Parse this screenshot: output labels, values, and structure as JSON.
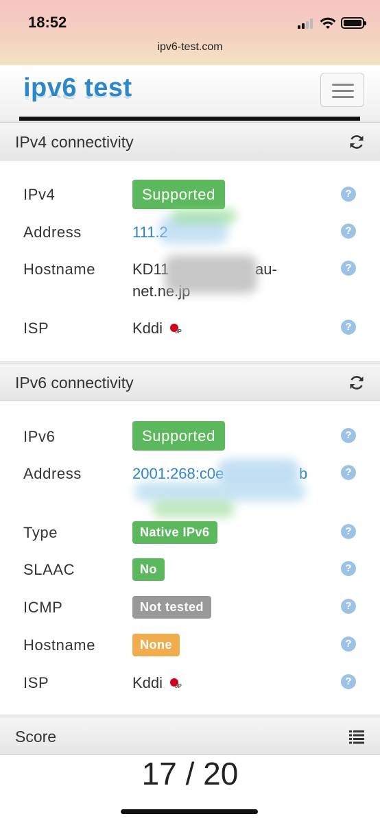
{
  "status_bar": {
    "time": "18:52"
  },
  "browser": {
    "url": "ipv6-test.com"
  },
  "navbar": {
    "logo_part1": "ipv6",
    "logo_part2": "test"
  },
  "ipv4": {
    "title": "IPv4 connectivity",
    "rows": {
      "status": {
        "label": "IPv4",
        "value": "Supported"
      },
      "address": {
        "label": "Address",
        "value": "111.2"
      },
      "hostname": {
        "label": "Hostname",
        "value_line1": "KD11",
        "value_line1_end": "au-",
        "value_line2": "net.ne.jp"
      },
      "isp": {
        "label": "ISP",
        "value": "Kddi",
        "flag_text": "JP"
      }
    }
  },
  "ipv6": {
    "title": "IPv6 connectivity",
    "rows": {
      "status": {
        "label": "IPv6",
        "value": "Supported"
      },
      "address": {
        "label": "Address",
        "value": "2001:268:c0e",
        "value_tail": "b"
      },
      "type": {
        "label": "Type",
        "value": "Native IPv6"
      },
      "slaac": {
        "label": "SLAAC",
        "value": "No"
      },
      "icmp": {
        "label": "ICMP",
        "value": "Not tested"
      },
      "hostname": {
        "label": "Hostname",
        "value": "None"
      },
      "isp": {
        "label": "ISP",
        "value": "Kddi",
        "flag_text": "JP"
      }
    }
  },
  "score": {
    "title": "Score",
    "value": "17 / 20"
  },
  "help_glyph": "?",
  "colors": {
    "success": "#5cb85c",
    "warning": "#f0ad4e",
    "neutral": "#999999",
    "link": "#2c82c9",
    "logo_blue": "#2d88c9",
    "logo_pink": "#e83a7c"
  },
  "icons": [
    "refresh-icon",
    "list-icon",
    "help-icon",
    "japan-flag-icon",
    "hamburger-icon"
  ]
}
